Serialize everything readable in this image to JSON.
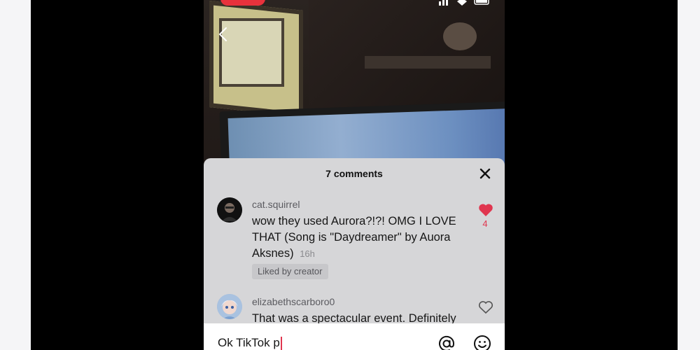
{
  "comments_panel": {
    "title": "7 comments",
    "comments": [
      {
        "username": "cat.squirrel",
        "text": "wow they used Aurora?!?! OMG I LOVE THAT (Song is \"Daydreamer\" by Auora Aksnes)",
        "time": "16h",
        "badge": "Liked by creator",
        "like_count": "4",
        "liked": true
      },
      {
        "username": "elizabethscarboro0",
        "text": "That was a spectacular event. Definitely",
        "liked": false
      }
    ]
  },
  "input": {
    "value": "Ok TikTok p"
  },
  "colors": {
    "heart_active": "#e0364f",
    "sheet_bg": "#d6d6d8",
    "record_red": "#e8323c"
  },
  "icons": [
    "chevron-left-icon",
    "close-icon",
    "heart-filled-icon",
    "heart-outline-icon",
    "at-icon",
    "emoji-icon",
    "signal-icon",
    "wifi-icon",
    "battery-icon"
  ]
}
